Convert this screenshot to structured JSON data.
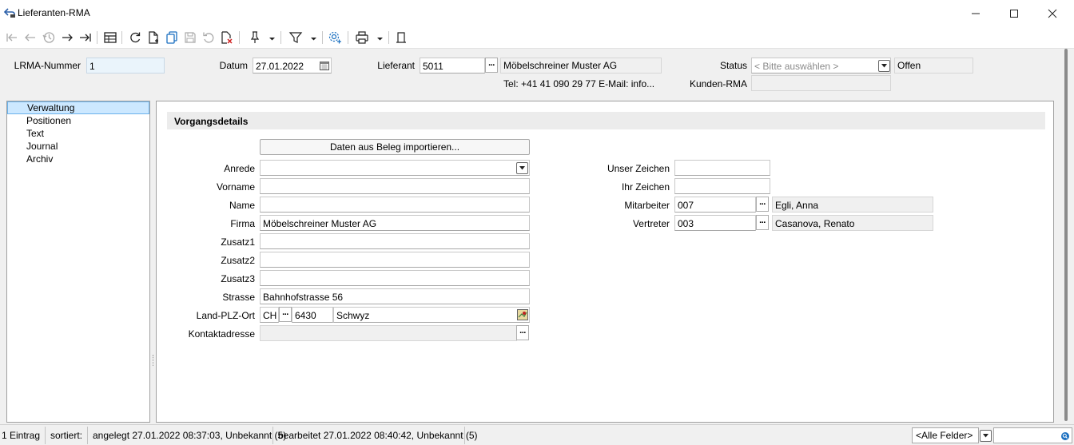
{
  "window": {
    "title": "Lieferanten-RMA"
  },
  "header": {
    "lrma_label": "LRMA-Nummer",
    "lrma_value": "1",
    "datum_label": "Datum",
    "datum_value": "27.01.2022",
    "lieferant_label": "Lieferant",
    "lieferant_value": "5011",
    "lieferant_name": "Möbelschreiner Muster AG",
    "contact_line": "Tel: +41 41 090 29 77   E-Mail: info...",
    "status_label": "Status",
    "status_placeholder": "< Bitte auswählen >",
    "status_value": "Offen",
    "kunden_rma_label": "Kunden-RMA",
    "kunden_rma_value": ""
  },
  "nav": {
    "items": [
      {
        "label": "Verwaltung",
        "selected": true
      },
      {
        "label": "Positionen"
      },
      {
        "label": "Text"
      },
      {
        "label": "Journal"
      },
      {
        "label": "Archiv"
      }
    ]
  },
  "main": {
    "section_title": "Vorgangsdetails",
    "import_button": "Daten aus Beleg importieren...",
    "anrede_label": "Anrede",
    "anrede_value": "",
    "vorname_label": "Vorname",
    "vorname_value": "",
    "name_label": "Name",
    "name_value": "",
    "firma_label": "Firma",
    "firma_value": "Möbelschreiner Muster AG",
    "zusatz1_label": "Zusatz1",
    "zusatz2_label": "Zusatz2",
    "zusatz3_label": "Zusatz3",
    "strasse_label": "Strasse",
    "strasse_value": "Bahnhofstrasse 56",
    "land_plz_ort_label": "Land-PLZ-Ort",
    "land_value": "CH",
    "plz_value": "6430",
    "ort_value": "Schwyz",
    "kontakt_label": "Kontaktadresse",
    "unser_zeichen_label": "Unser Zeichen",
    "ihr_zeichen_label": "Ihr Zeichen",
    "mitarbeiter_label": "Mitarbeiter",
    "mitarbeiter_value": "007",
    "mitarbeiter_name": "Egli, Anna",
    "vertreter_label": "Vertreter",
    "vertreter_value": "003",
    "vertreter_name": "Casanova, Renato",
    "dots": "..."
  },
  "statusbar": {
    "count": "1 Eintrag",
    "sort": "sortiert:",
    "created": "angelegt 27.01.2022 08:37:03, Unbekannt (5)",
    "edited": "bearbeitet 27.01.2022 08:40:42, Unbekannt (5)",
    "filter_field": "<Alle Felder>"
  }
}
